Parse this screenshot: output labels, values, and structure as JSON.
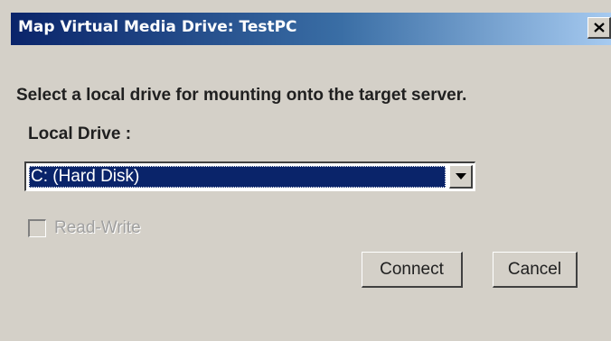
{
  "dialog": {
    "title": "Map Virtual Media Drive: TestPC",
    "close_icon": "close-x-icon",
    "instruction": "Select a local drive for mounting onto the target server.",
    "drive_label": "Local Drive :",
    "drive_select": {
      "selected": "C: (Hard Disk)",
      "arrow_icon": "dropdown-arrow-icon"
    },
    "read_write": {
      "label": "Read-Write",
      "checked": false,
      "enabled": false
    },
    "buttons": {
      "connect": "Connect",
      "cancel": "Cancel"
    },
    "colors": {
      "titlebar_start": "#0a246a",
      "titlebar_end": "#a6caf0",
      "dialog_bg": "#d4d0c8",
      "selection_bg": "#0a246a"
    }
  }
}
